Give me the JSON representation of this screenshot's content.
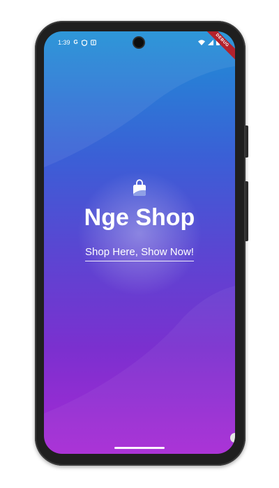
{
  "status_bar": {
    "time": "1:39",
    "left_icons": [
      "google-icon",
      "shield-icon",
      "alert-icon"
    ],
    "right_icons": [
      "wifi-icon",
      "signal-icon",
      "battery-icon"
    ],
    "debug_label": "DEBUG"
  },
  "splash": {
    "app_name": "Nge Shop",
    "tagline": "Shop Here, Show Now!",
    "logo_icon": "shopping-bag-icon"
  },
  "colors": {
    "gradient_top": "#1f8fd6",
    "gradient_mid": "#5a46d2",
    "gradient_bottom": "#a72ad4",
    "text": "#ffffff",
    "debug_ribbon": "#b3222c"
  }
}
